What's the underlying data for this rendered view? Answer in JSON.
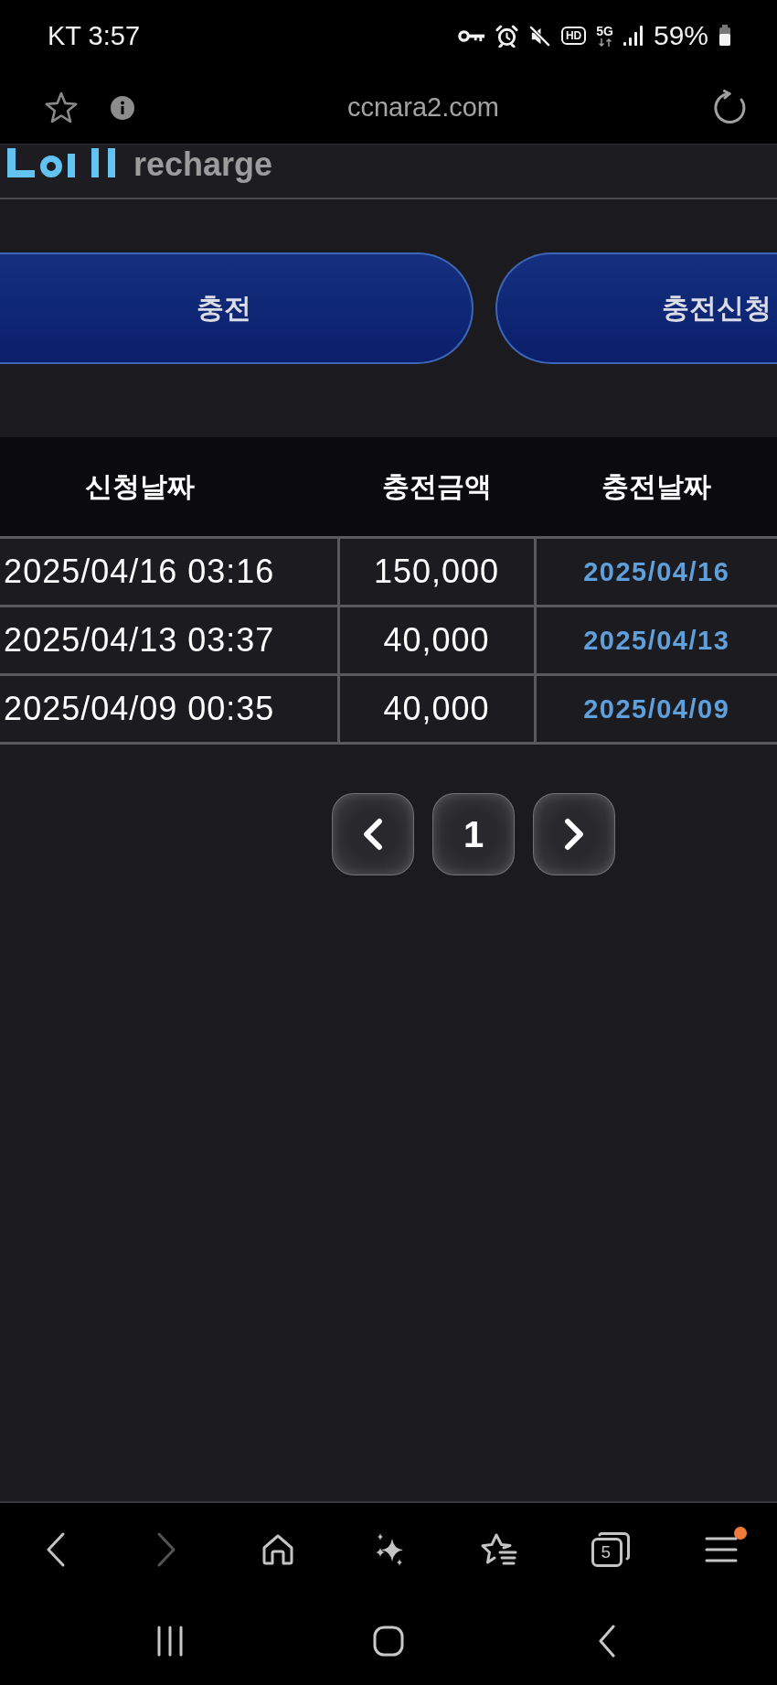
{
  "status_bar": {
    "time": "KT 3:57",
    "hd": "HD",
    "network": "5G",
    "battery": "59%"
  },
  "address_bar": {
    "url": "ccnara2.com"
  },
  "header": {
    "logo_text": "recharge"
  },
  "action_buttons": [
    {
      "label": "충전"
    },
    {
      "label": "충전신청"
    }
  ],
  "table": {
    "columns": [
      "신청날짜",
      "충전금액",
      "충전날짜"
    ],
    "rows": [
      [
        "2025/04/16 03:16",
        "150,000",
        "2025/04/16"
      ],
      [
        "2025/04/13 03:37",
        "40,000",
        "2025/04/13"
      ],
      [
        "2025/04/09 00:35",
        "40,000",
        "2025/04/09"
      ]
    ]
  },
  "pagination": {
    "pages": [
      "1"
    ]
  },
  "browser_toolbar": [
    {
      "kind": "back",
      "disabled": false,
      "notification": false
    },
    {
      "kind": "forward",
      "disabled": true,
      "notification": false
    },
    {
      "kind": "home",
      "disabled": false,
      "notification": false
    },
    {
      "kind": "assistant",
      "disabled": false,
      "notification": false
    },
    {
      "kind": "bookmarks",
      "disabled": false,
      "notification": false
    },
    {
      "kind": "tabs",
      "count": "5",
      "disabled": false,
      "notification": false
    },
    {
      "kind": "menu",
      "disabled": false,
      "notification": true
    }
  ],
  "nav_bar": [
    {
      "kind": "recents"
    },
    {
      "kind": "home"
    },
    {
      "kind": "back"
    }
  ]
}
